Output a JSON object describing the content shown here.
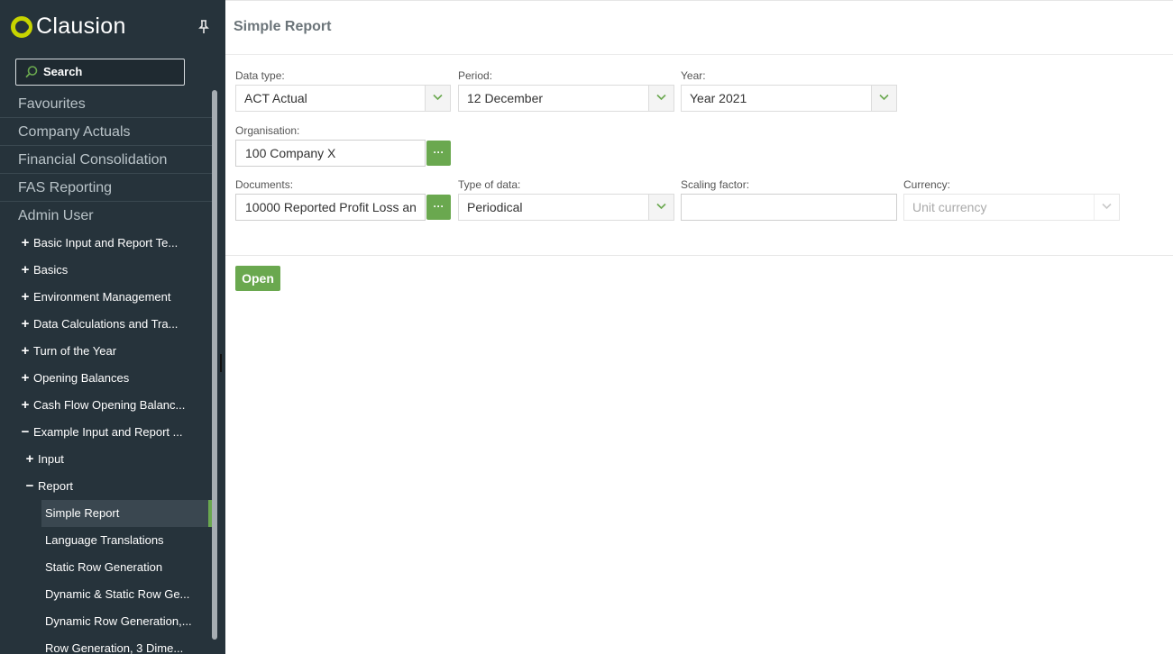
{
  "app": {
    "logo_text": "Clausion"
  },
  "search": {
    "label": "Search"
  },
  "sections": [
    "Favourites",
    "Company Actuals",
    "Financial Consolidation",
    "FAS Reporting",
    "Admin User"
  ],
  "tree": [
    {
      "sign": "+",
      "label": "Basic Input and Report Te..."
    },
    {
      "sign": "+",
      "label": "Basics"
    },
    {
      "sign": "+",
      "label": "Environment Management"
    },
    {
      "sign": "+",
      "label": "Data Calculations and Tra..."
    },
    {
      "sign": "+",
      "label": "Turn of the Year"
    },
    {
      "sign": "+",
      "label": "Opening Balances"
    },
    {
      "sign": "+",
      "label": "Cash Flow Opening Balanc..."
    },
    {
      "sign": "−",
      "label": "Example Input and Report ..."
    },
    {
      "sign": "+",
      "label": "Input"
    },
    {
      "sign": "−",
      "label": "Report"
    },
    {
      "label": "Simple Report"
    },
    {
      "label": "Language Translations"
    },
    {
      "label": "Static Row Generation"
    },
    {
      "label": "Dynamic & Static Row Ge..."
    },
    {
      "label": "Dynamic Row Generation,..."
    },
    {
      "label": "Row Generation, 3 Dime..."
    }
  ],
  "main": {
    "title": "Simple Report",
    "fields": {
      "data_type": {
        "label": "Data type:",
        "value": "ACT Actual"
      },
      "period": {
        "label": "Period:",
        "value": "12 December"
      },
      "year": {
        "label": "Year:",
        "value": "Year 2021"
      },
      "organisation": {
        "label": "Organisation:",
        "value": "100 Company X"
      },
      "documents": {
        "label": "Documents:",
        "value": "10000 Reported Profit Loss an"
      },
      "type_of_data": {
        "label": "Type of data:",
        "value": "Periodical"
      },
      "scaling_factor": {
        "label": "Scaling factor:",
        "value": ""
      },
      "currency": {
        "label": "Currency:",
        "value": "Unit currency"
      }
    },
    "browse_label": "···",
    "open_label": "Open"
  },
  "colors": {
    "sidebar_bg": "#26333b",
    "accent_green": "#6aa84f",
    "logo_yellow": "#c7d400"
  }
}
